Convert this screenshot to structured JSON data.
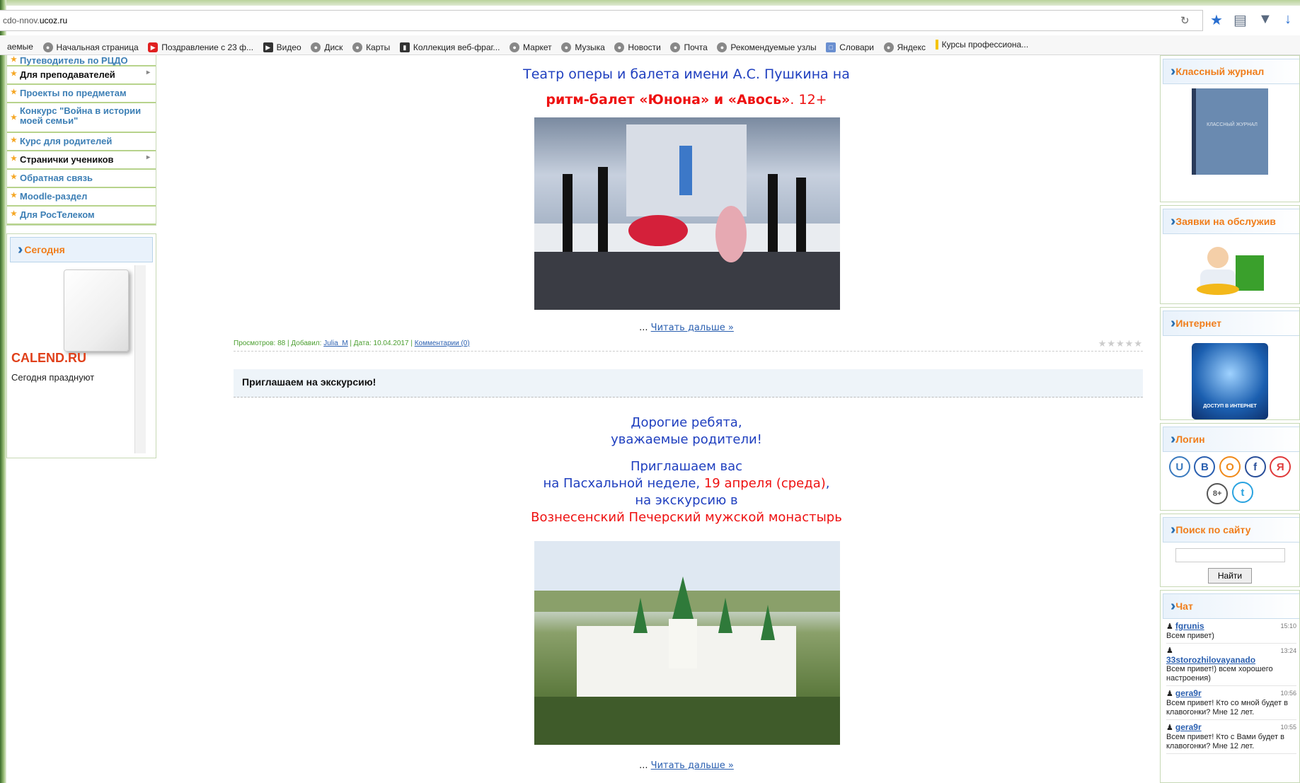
{
  "browser": {
    "url_prefix": "cdo-nnov.",
    "url_domain": "ucoz.ru",
    "bookmarks": [
      "аемые",
      "Начальная страница",
      "Поздравление с 23 ф...",
      "Видео",
      "Диск",
      "Карты",
      "Коллекция веб-фраг...",
      "Маркет",
      "Музыка",
      "Новости",
      "Почта",
      "Рекомендуемые узлы",
      "Словари",
      "Яндекс",
      "Курсы профессиона..."
    ]
  },
  "left_menu": {
    "items": [
      "Путеводитель по РЦДО",
      "Для преподавателей",
      "Проекты по предметам",
      "Конкурс \"Война в истории моей семьи\"",
      "Курс для родителей",
      "Странички учеников",
      "Обратная связь",
      "Moodle-раздел",
      "Для РосТелеком"
    ]
  },
  "today_widget": {
    "title": "Сегодня",
    "brand": "CALEND.RU",
    "subtitle": "Сегодня празднуют"
  },
  "post1": {
    "title_line1": "Театр оперы и балета имени А.С. Пушкина на",
    "title_line2_red": "ритм-балет «Юнона» и «Авось»",
    "title_line2_tail": ". 12+",
    "read_more_prefix": "... ",
    "read_more": "Читать дальше »",
    "meta_views": "Просмотров: 88 | Добавил: ",
    "meta_author": "Julia_M",
    "meta_date": " | Дата: 10.04.2017 | ",
    "meta_comments": "Комментарии (0)",
    "rating": "★★★★★"
  },
  "post2": {
    "heading": "Приглашаем на экскурсию!",
    "greet1": "Дорогие ребята,",
    "greet2": "уважаемые родители!",
    "invite1": "Приглашаем вас",
    "invite2a": "на Пасхальной неделе, ",
    "invite2b": "19 апреля (среда)",
    "invite2c": ",",
    "invite3": "на экскурсию в",
    "invite4": "Вознесенский Печерский мужской монастырь",
    "read_more_prefix": "... ",
    "read_more": "Читать дальше »"
  },
  "right_sidebar": {
    "journal_title": "Классный журнал",
    "journal_cover": "КЛАССНЫЙ ЖУРНАЛ",
    "service_title": "Заявки на обслужив",
    "internet_title": "Интернет",
    "internet_banner": "ДОСТУП В ИНТЕРНЕТ",
    "login_title": "Логин",
    "social": [
      "U",
      "B",
      "О",
      "f",
      "Я",
      "8+",
      "t"
    ],
    "search_title": "Поиск по сайту",
    "search_button": "Найти",
    "chat_title": "Чат",
    "chat": [
      {
        "user": "fgrunis",
        "time": "15:10",
        "text": "Всем привет)"
      },
      {
        "user": "33storozhilovayanado",
        "time": "13:24",
        "text": "Всем привет!) всем хорошего настроения)"
      },
      {
        "user": "gera9r",
        "time": "10:56",
        "text": "Всем привет! Кто со мной будет в клавогонки? Мне 12 лет."
      },
      {
        "user": "gera9r",
        "time": "10:55",
        "text": "Всем привет! Кто с Вами будет в клавогонки? Мне 12 лет."
      }
    ]
  },
  "colors": {
    "accent_orange": "#f07d1a",
    "link_blue": "#3d7fb5",
    "title_blue": "#1f3fbf",
    "title_red": "#e11"
  }
}
